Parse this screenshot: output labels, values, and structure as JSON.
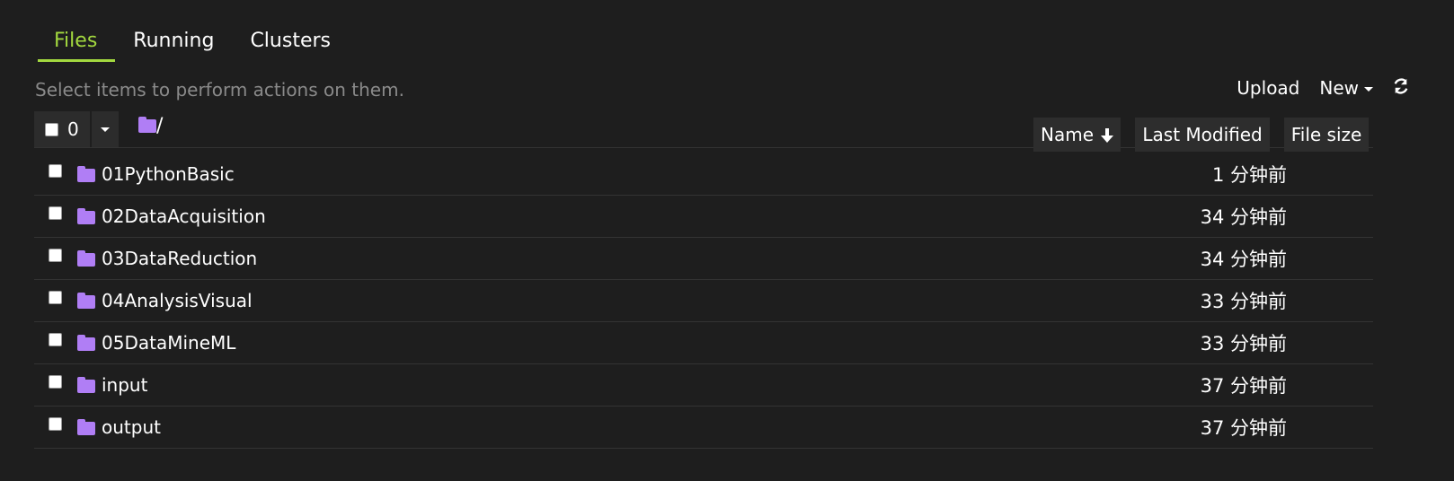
{
  "tabs": [
    {
      "label": "Files"
    },
    {
      "label": "Running"
    },
    {
      "label": "Clusters"
    }
  ],
  "hint": "Select items to perform actions on them.",
  "actions": {
    "upload_label": "Upload",
    "new_label": "New",
    "refresh_icon": "refresh-icon"
  },
  "toolbar": {
    "selected_count": "0",
    "breadcrumb": "/"
  },
  "sort": {
    "name_label": "Name",
    "modified_label": "Last Modified",
    "size_label": "File size"
  },
  "files": [
    {
      "name": "01PythonBasic",
      "modified": "1 分钟前"
    },
    {
      "name": "02DataAcquisition",
      "modified": "34 分钟前"
    },
    {
      "name": "03DataReduction",
      "modified": "34 分钟前"
    },
    {
      "name": "04AnalysisVisual",
      "modified": "33 分钟前"
    },
    {
      "name": "05DataMineML",
      "modified": "33 分钟前"
    },
    {
      "name": "input",
      "modified": "37 分钟前"
    },
    {
      "name": "output",
      "modified": "37 分钟前"
    }
  ],
  "colors": {
    "accent": "#a3d93f",
    "folder": "#b07ef5",
    "background": "#1e1e1e"
  }
}
